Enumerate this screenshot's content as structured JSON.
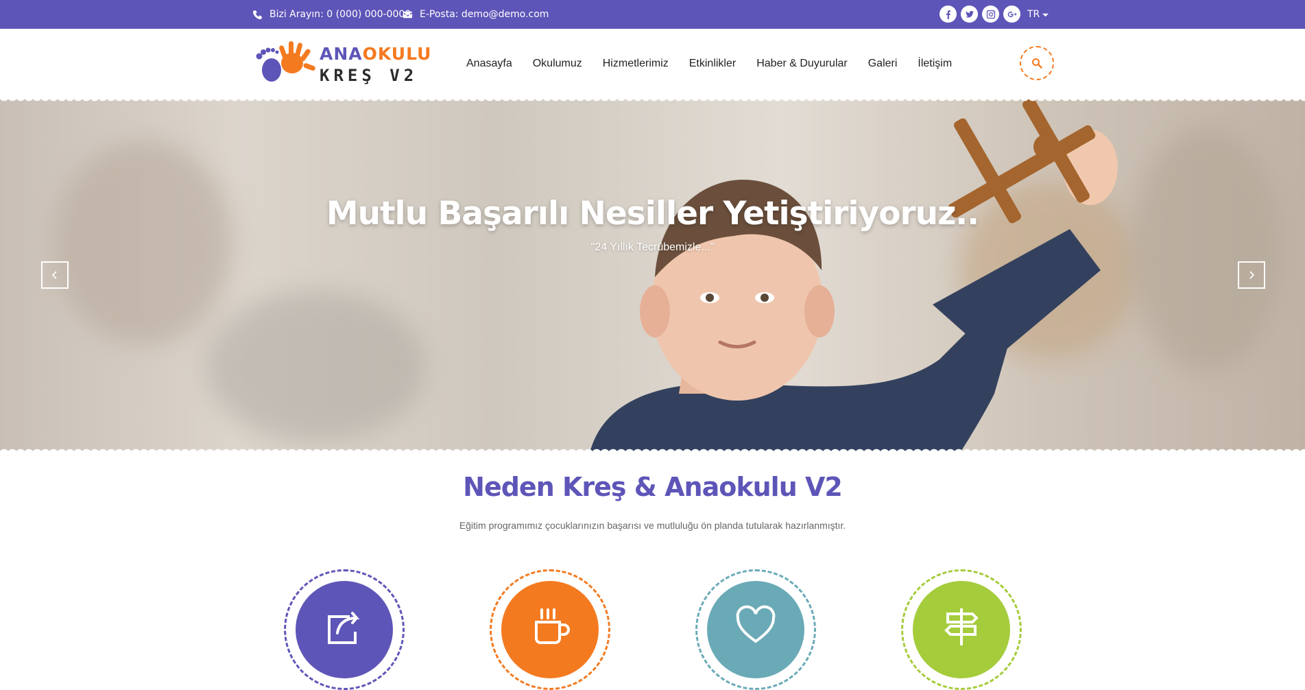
{
  "topbar": {
    "phone_label": "Bizi Arayın: 0 (000) 000-0000",
    "email_label": "E-Posta: demo@demo.com",
    "language": "TR",
    "socials": [
      "facebook-icon",
      "twitter-icon",
      "instagram-icon",
      "google-plus-icon"
    ]
  },
  "logo": {
    "line1_a": "ANA",
    "line1_b": "OKULU",
    "line2": "KREŞ V2"
  },
  "nav": {
    "items": [
      {
        "label": "Anasayfa"
      },
      {
        "label": "Okulumuz"
      },
      {
        "label": "Hizmetlerimiz"
      },
      {
        "label": "Etkinlikler"
      },
      {
        "label": "Haber & Duyurular"
      },
      {
        "label": "Galeri"
      },
      {
        "label": "İletişim"
      }
    ]
  },
  "hero": {
    "title": "Mutlu Başarılı Nesiller Yetiştiriyoruz..",
    "subtitle": "\"24 Yıllık Tecrübemizle...\""
  },
  "section": {
    "title": "Neden Kreş & Anaokulu V2",
    "subtitle": "Eğitim programımız çocuklarınızın başarısı ve mutluluğu ön planda tutularak hazırlanmıştır."
  },
  "features": [
    {
      "icon": "share-icon",
      "color": "#5e55b8"
    },
    {
      "icon": "coffee-cup-icon",
      "color": "#f47a20"
    },
    {
      "icon": "heart-icon",
      "color": "#6aaab7"
    },
    {
      "icon": "signpost-icon",
      "color": "#a5cc3b"
    }
  ],
  "colors": {
    "brand_purple": "#5e55b8",
    "brand_orange": "#f47a20",
    "teal": "#6aaab7",
    "lime": "#a5cc3b"
  }
}
